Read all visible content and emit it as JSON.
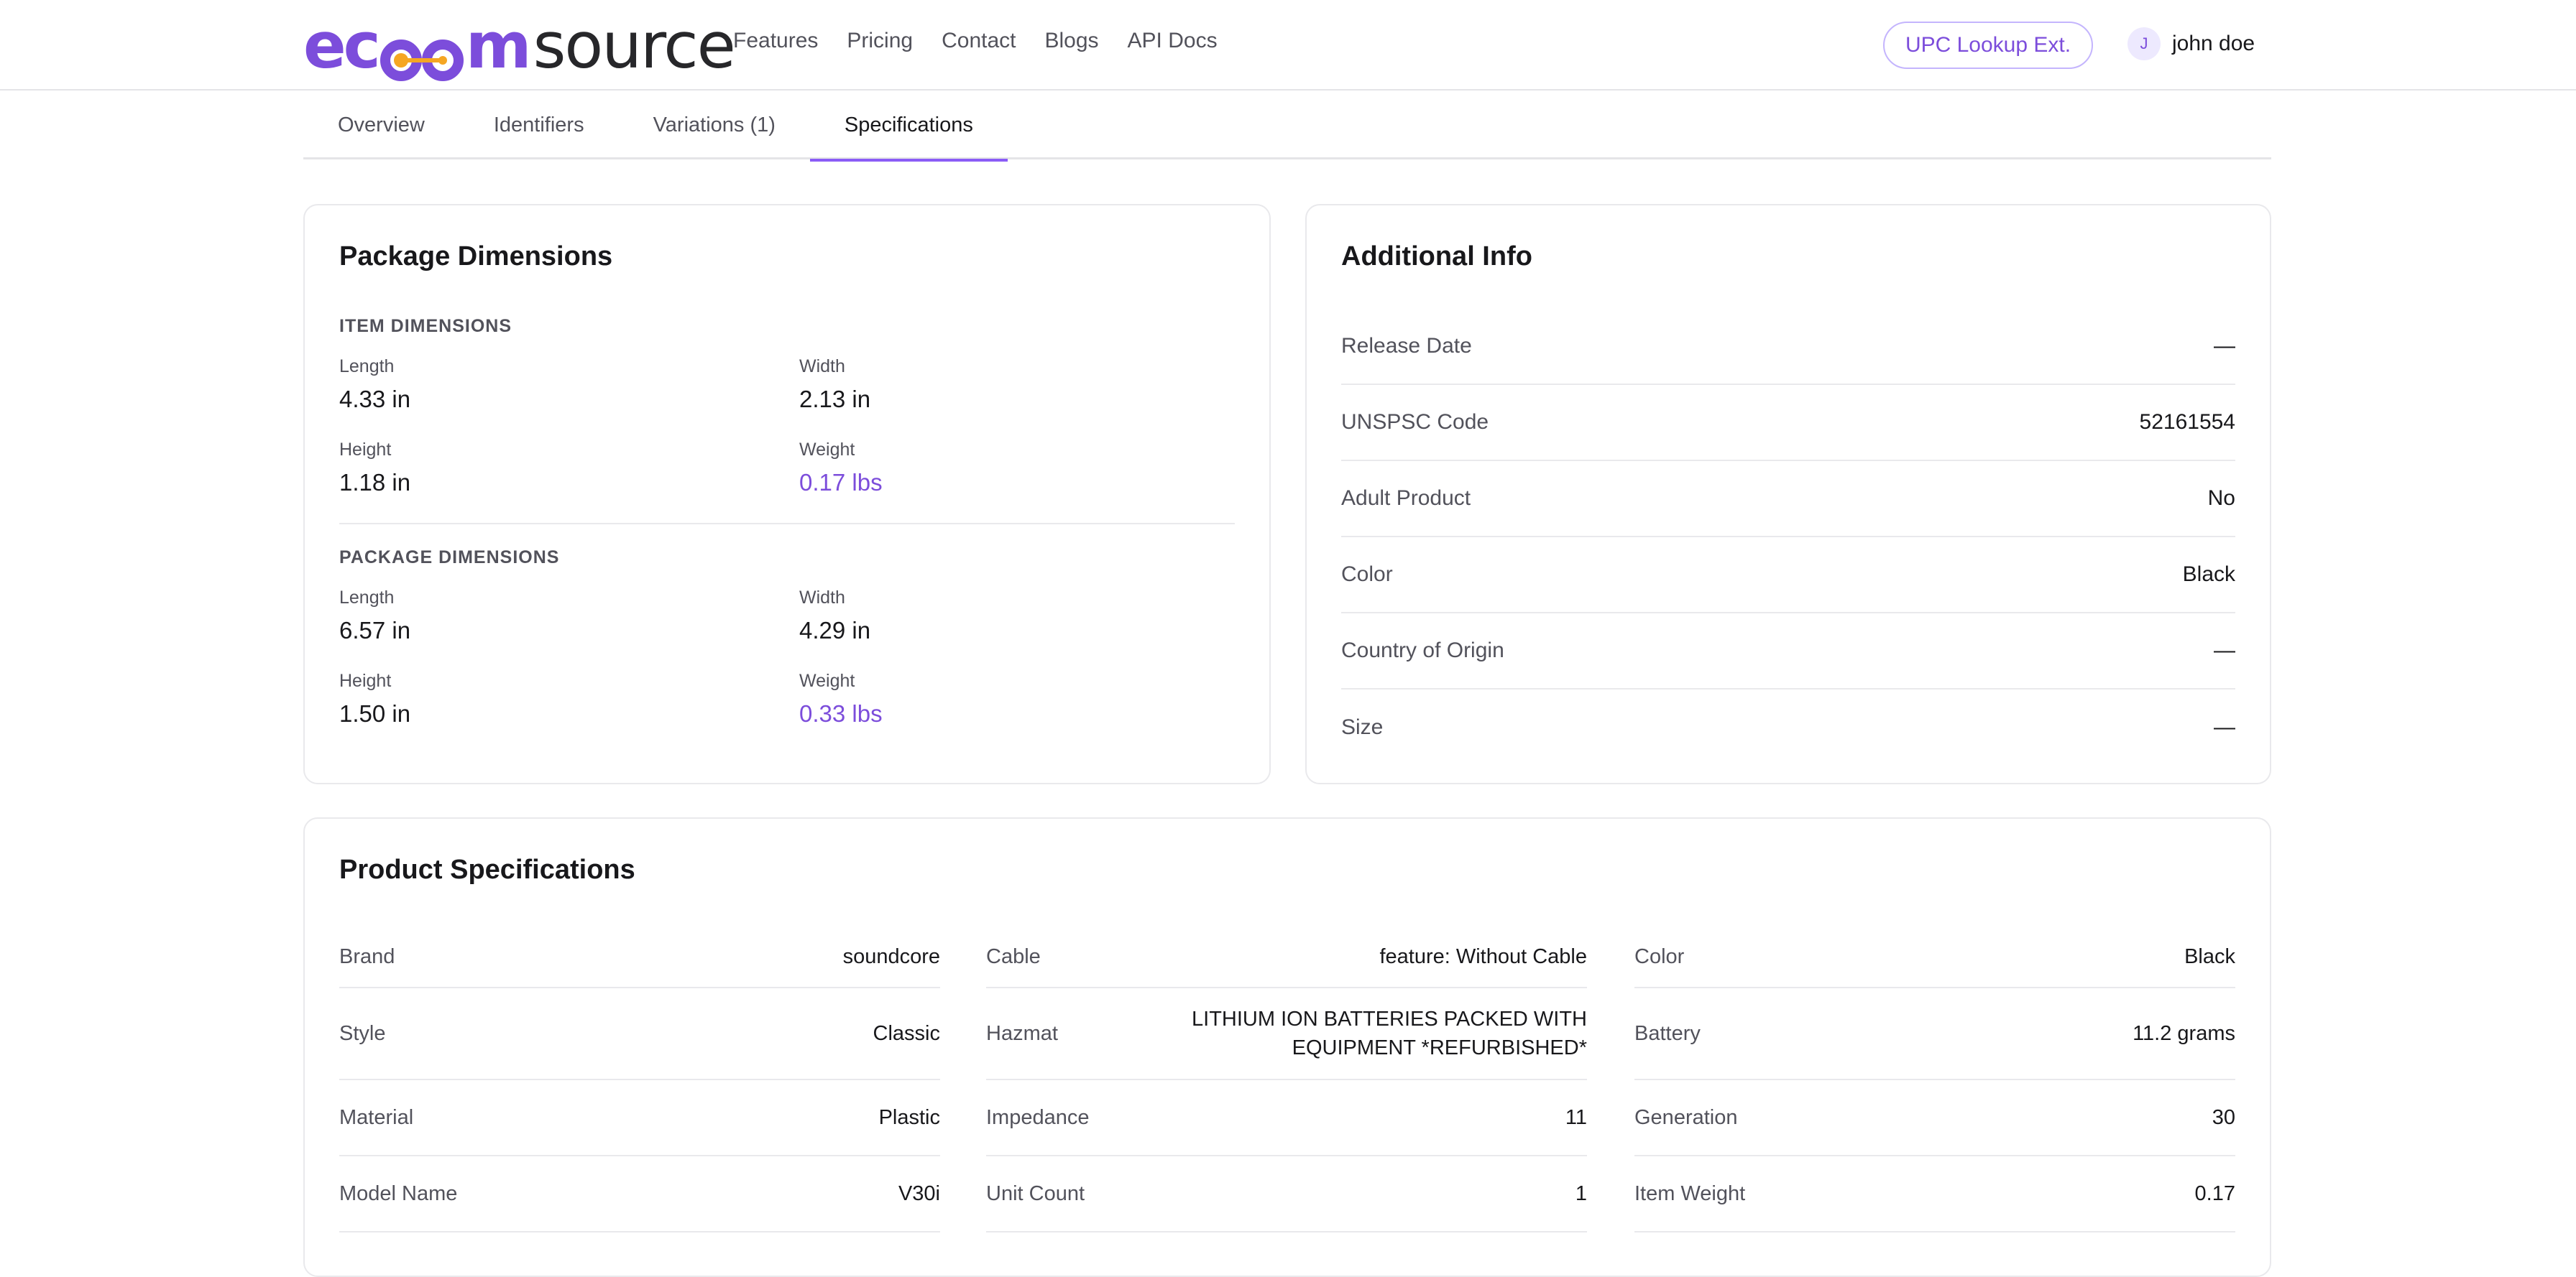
{
  "brand": {
    "logo_left": "ec",
    "logo_mid": "m",
    "logo_right": "source"
  },
  "nav": [
    "Features",
    "Pricing",
    "Contact",
    "Blogs",
    "API Docs"
  ],
  "upc_button": "UPC Lookup Ext.",
  "user": {
    "initial": "J",
    "name": "john doe"
  },
  "tabs": [
    "Overview",
    "Identifiers",
    "Variations (1)",
    "Specifications"
  ],
  "package": {
    "title": "Package Dimensions",
    "item_label": "ITEM DIMENSIONS",
    "item": [
      {
        "label": "Length",
        "value": "4.33 in"
      },
      {
        "label": "Width",
        "value": "2.13 in"
      },
      {
        "label": "Height",
        "value": "1.18 in"
      },
      {
        "label": "Weight",
        "value": "0.17 lbs"
      }
    ],
    "package_label": "PACKAGE DIMENSIONS",
    "pkg": [
      {
        "label": "Length",
        "value": "6.57 in"
      },
      {
        "label": "Width",
        "value": "4.29 in"
      },
      {
        "label": "Height",
        "value": "1.50 in"
      },
      {
        "label": "Weight",
        "value": "0.33 lbs"
      }
    ]
  },
  "additional": {
    "title": "Additional Info",
    "rows": [
      {
        "key": "Release Date",
        "value": "—"
      },
      {
        "key": "UNSPSC Code",
        "value": "52161554"
      },
      {
        "key": "Adult Product",
        "value": "No"
      },
      {
        "key": "Color",
        "value": "Black"
      },
      {
        "key": "Country of Origin",
        "value": "—"
      },
      {
        "key": "Size",
        "value": "—"
      }
    ]
  },
  "specs": {
    "title": "Product Specifications",
    "cells": [
      {
        "key": "Brand",
        "value": "soundcore"
      },
      {
        "key": "Cable",
        "value": "feature: Without Cable"
      },
      {
        "key": "Color",
        "value": "Black"
      },
      {
        "key": "Style",
        "value": "Classic"
      },
      {
        "key": "Hazmat",
        "value": "LITHIUM ION BATTERIES PACKED WITH EQUIPMENT *REFURBISHED*"
      },
      {
        "key": "Battery",
        "value": "11.2 grams"
      },
      {
        "key": "Material",
        "value": "Plastic"
      },
      {
        "key": "Impedance",
        "value": "11"
      },
      {
        "key": "Generation",
        "value": "30"
      },
      {
        "key": "Model Name",
        "value": "V30i"
      },
      {
        "key": "Unit Count",
        "value": "1"
      },
      {
        "key": "Item Weight",
        "value": "0.17"
      }
    ]
  },
  "colors": {
    "accent": "#7c4ddb",
    "accent_light": "#c4b5fd",
    "border": "#e9e9ec",
    "muted": "#52525b"
  }
}
